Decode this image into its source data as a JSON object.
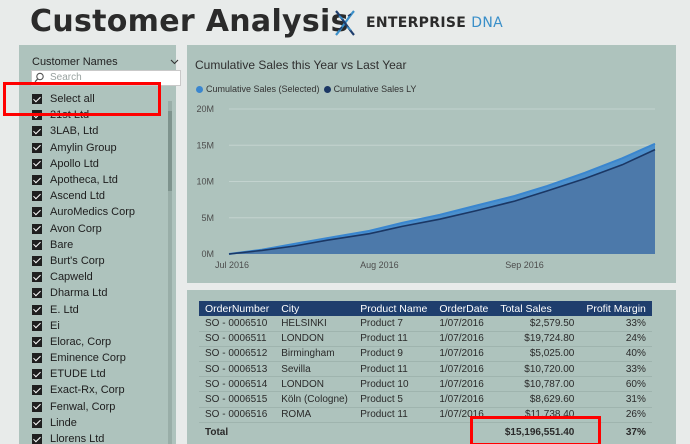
{
  "header": {
    "title": "Customer Analysis",
    "brand_main": "ENTERPRISE",
    "brand_accent": "DNA"
  },
  "slicer": {
    "title": "Customer Names",
    "search_placeholder": "Search",
    "select_all_label": "Select all",
    "items": [
      "21st Ltd",
      "3LAB, Ltd",
      "Amylin Group",
      "Apollo Ltd",
      "Apotheca, Ltd",
      "Ascend Ltd",
      "AuroMedics Corp",
      "Avon Corp",
      "Bare",
      "Burt's Corp",
      "Capweld",
      "Dharma Ltd",
      "E. Ltd",
      "Ei",
      "Elorac, Corp",
      "Eminence Corp",
      "ETUDE Ltd",
      "Exact-Rx, Corp",
      "Fenwal, Corp",
      "Linde",
      "Llorens Ltd"
    ]
  },
  "chart": {
    "title": "Cumulative Sales this Year vs Last Year"
  },
  "chart_data": {
    "type": "area",
    "title": "Cumulative Sales this Year vs Last Year",
    "x_range": [
      "2016-07-01",
      "2016-09-30"
    ],
    "x_ticks": [
      "Jul 2016",
      "Aug 2016",
      "Sep 2016"
    ],
    "y_ticks": [
      "0M",
      "5M",
      "10M",
      "15M",
      "20M"
    ],
    "ylim": [
      0,
      20000000
    ],
    "legend_position": "top-left",
    "series": [
      {
        "name": "Cumulative Sales (Selected)",
        "color": "#3a86cf",
        "points": [
          [
            "2016-07-01",
            0
          ],
          [
            "2016-07-08",
            600000
          ],
          [
            "2016-07-15",
            1400000
          ],
          [
            "2016-07-22",
            2200000
          ],
          [
            "2016-07-31",
            3200000
          ],
          [
            "2016-08-07",
            4300000
          ],
          [
            "2016-08-15",
            5400000
          ],
          [
            "2016-08-23",
            6700000
          ],
          [
            "2016-08-31",
            8000000
          ],
          [
            "2016-09-07",
            9400000
          ],
          [
            "2016-09-15",
            11200000
          ],
          [
            "2016-09-23",
            13200000
          ],
          [
            "2016-09-30",
            15200000
          ]
        ]
      },
      {
        "name": "Cumulative Sales LY",
        "color": "#1b3764",
        "points": [
          [
            "2016-07-01",
            0
          ],
          [
            "2016-07-08",
            500000
          ],
          [
            "2016-07-15",
            1100000
          ],
          [
            "2016-07-22",
            1900000
          ],
          [
            "2016-07-31",
            2800000
          ],
          [
            "2016-08-07",
            3800000
          ],
          [
            "2016-08-15",
            4800000
          ],
          [
            "2016-08-23",
            6000000
          ],
          [
            "2016-08-31",
            7300000
          ],
          [
            "2016-09-07",
            8700000
          ],
          [
            "2016-09-15",
            10400000
          ],
          [
            "2016-09-23",
            12300000
          ],
          [
            "2016-09-30",
            14400000
          ]
        ]
      }
    ]
  },
  "table": {
    "columns": [
      "OrderNumber",
      "City",
      "Product Name",
      "OrderDate",
      "Total Sales",
      "Profit Margin"
    ],
    "rows": [
      [
        "SO - 0006510",
        "HELSINKI",
        "Product 7",
        "1/07/2016",
        "$2,579.50",
        "33%"
      ],
      [
        "SO - 0006511",
        "LONDON",
        "Product 11",
        "1/07/2016",
        "$19,724.80",
        "24%"
      ],
      [
        "SO - 0006512",
        "Birmingham",
        "Product 9",
        "1/07/2016",
        "$5,025.00",
        "40%"
      ],
      [
        "SO - 0006513",
        "Sevilla",
        "Product 11",
        "1/07/2016",
        "$10,720.00",
        "33%"
      ],
      [
        "SO - 0006514",
        "LONDON",
        "Product 10",
        "1/07/2016",
        "$10,787.00",
        "60%"
      ],
      [
        "SO - 0006515",
        "Köln (Cologne)",
        "Product 5",
        "1/07/2016",
        "$8,629.60",
        "31%"
      ],
      [
        "SO - 0006516",
        "ROMA",
        "Product 11",
        "1/07/2016",
        "$11,738.40",
        "26%"
      ]
    ],
    "total_label": "Total",
    "total_sales": "$15,196,551.40",
    "total_margin": "37%"
  },
  "colors": {
    "panel_bg": "#aec3bd",
    "table_header": "#1f3e6d",
    "annotation_red": "#ff0000"
  }
}
